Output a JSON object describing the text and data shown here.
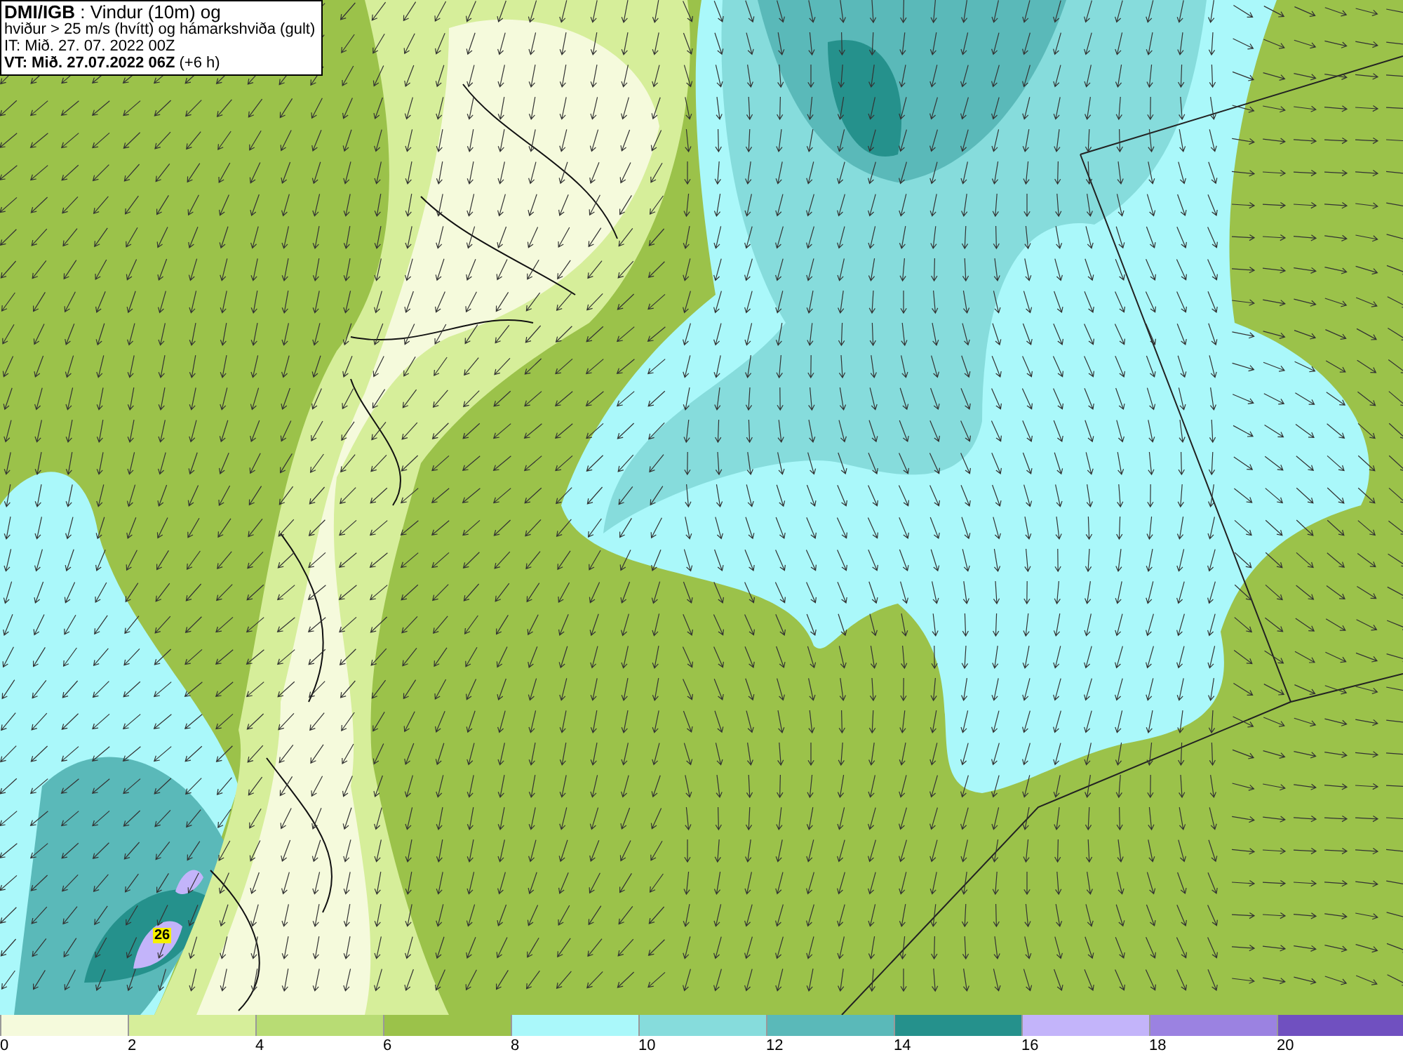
{
  "header": {
    "lines": [
      "**DMI/IGB** : Vindur (10m) og",
      "hviður > 25 m/s (hvítt) og hámarkshviða (gult)",
      "IT: Mið. 27. 07. 2022 00Z",
      "**VT: Mið. 27.07.2022 06Z** (+6 h)"
    ]
  },
  "map": {
    "gust_labels": [
      "26"
    ]
  },
  "legend": [
    {
      "label": "0",
      "color": "#f5fadc"
    },
    {
      "label": "2",
      "color": "#d6ee9a"
    },
    {
      "label": "4",
      "color": "#b8dc74"
    },
    {
      "label": "6",
      "color": "#9bc24a"
    },
    {
      "label": "8",
      "color": "#aaf8fa"
    },
    {
      "label": "10",
      "color": "#86dcdc"
    },
    {
      "label": "12",
      "color": "#5ab9b9"
    },
    {
      "label": "14",
      "color": "#25918c"
    },
    {
      "label": "16",
      "color": "#c3b4fa"
    },
    {
      "label": "18",
      "color": "#9b82e1"
    },
    {
      "label": "20",
      "color": "#7050c0"
    }
  ]
}
